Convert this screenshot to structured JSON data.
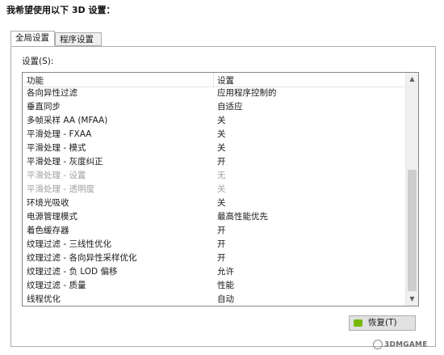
{
  "header": {
    "title": "我希望使用以下 3D 设置："
  },
  "tabs": [
    {
      "label": "全局设置",
      "active": true
    },
    {
      "label": "程序设置",
      "active": false
    }
  ],
  "panel": {
    "settings_label": "设置(S):"
  },
  "table": {
    "columns": [
      "功能",
      "设置"
    ],
    "rows": [
      {
        "feature": "各向异性过滤",
        "value": "应用程序控制的",
        "enabled": true
      },
      {
        "feature": "垂直同步",
        "value": "自适应",
        "enabled": true
      },
      {
        "feature": "多帧采样 AA (MFAA)",
        "value": "关",
        "enabled": true
      },
      {
        "feature": "平滑处理 - FXAA",
        "value": "关",
        "enabled": true
      },
      {
        "feature": "平滑处理 - 模式",
        "value": "关",
        "enabled": true
      },
      {
        "feature": "平滑处理 - 灰度纠正",
        "value": "开",
        "enabled": true
      },
      {
        "feature": "平滑处理 - 设置",
        "value": "无",
        "enabled": false
      },
      {
        "feature": "平滑处理 - 透明度",
        "value": "关",
        "enabled": false
      },
      {
        "feature": "环境光吸收",
        "value": "关",
        "enabled": true
      },
      {
        "feature": "电源管理模式",
        "value": "最高性能优先",
        "enabled": true
      },
      {
        "feature": "着色缓存器",
        "value": "开",
        "enabled": true
      },
      {
        "feature": "纹理过滤 - 三线性优化",
        "value": "开",
        "enabled": true
      },
      {
        "feature": "纹理过滤 - 各向异性采样优化",
        "value": "开",
        "enabled": true
      },
      {
        "feature": "纹理过滤 - 负 LOD 偏移",
        "value": "允许",
        "enabled": true
      },
      {
        "feature": "纹理过滤 - 质量",
        "value": "性能",
        "enabled": true
      },
      {
        "feature": "线程优化",
        "value": "自动",
        "enabled": true
      }
    ]
  },
  "buttons": {
    "restore_label": "恢复(T)"
  },
  "icons": {
    "restore": "nvidia-icon",
    "scroll_up": "chevron-up-icon",
    "scroll_down": "chevron-down-icon"
  },
  "colors": {
    "nvidia_green": "#76b900",
    "disabled_text": "#a0a0a0"
  },
  "watermark": {
    "text": "3DMGAME"
  }
}
